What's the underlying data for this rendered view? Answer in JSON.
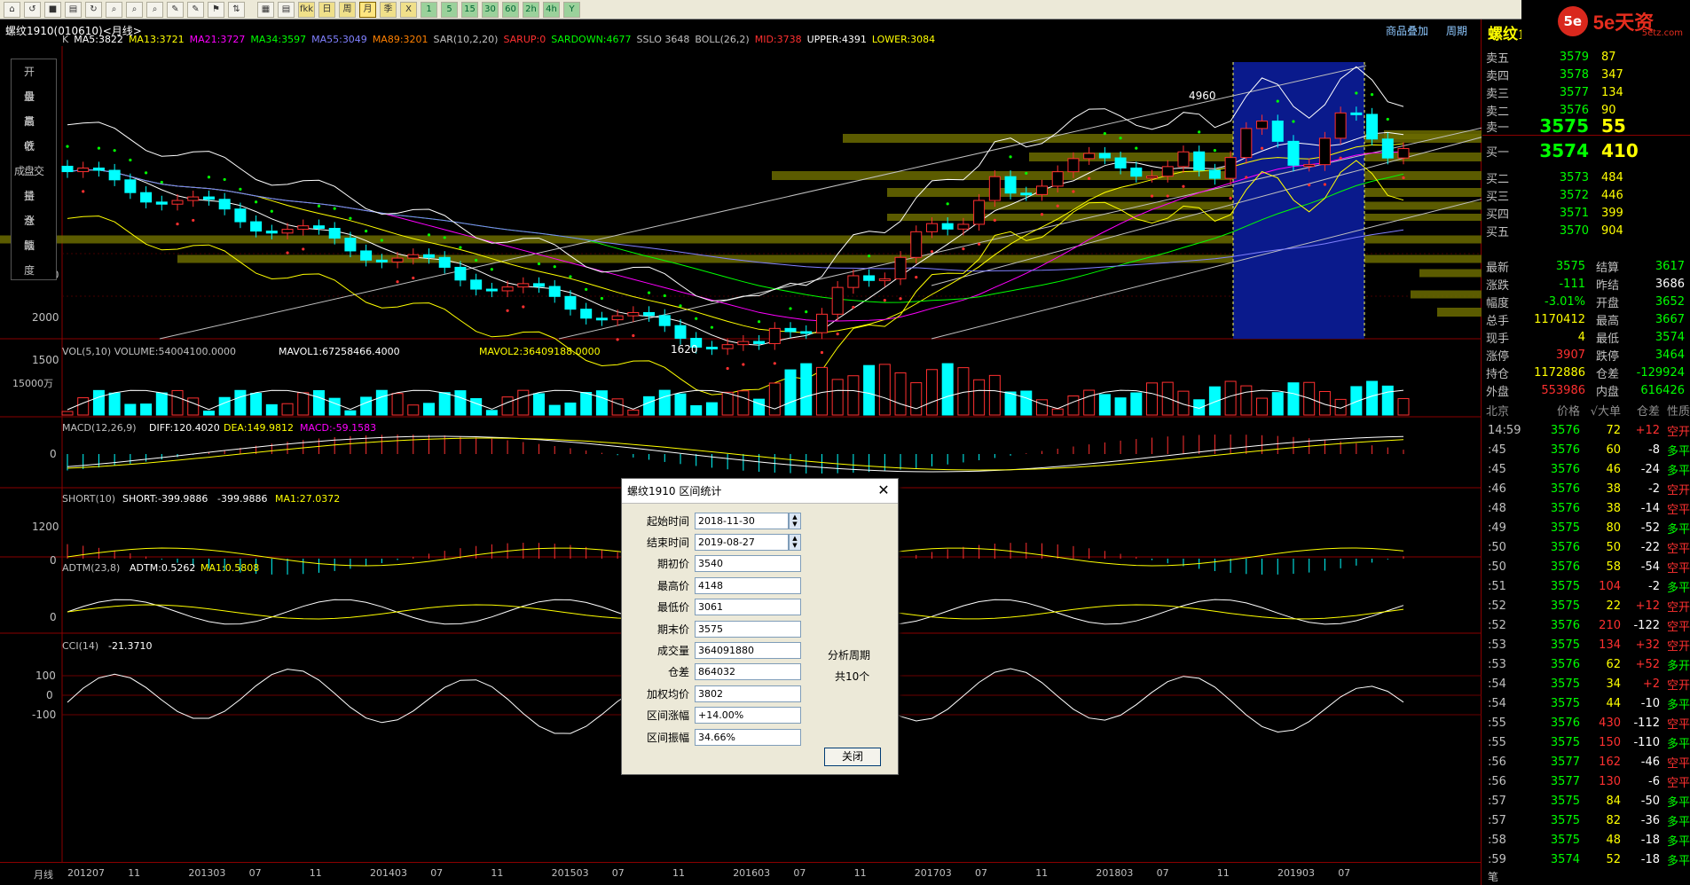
{
  "toolbar": {
    "period_buttons": [
      "1",
      "5",
      "15",
      "30",
      "60",
      "2h",
      "4h",
      "Y"
    ],
    "other_buttons": [
      "fkk",
      "日",
      "周",
      "月",
      "季",
      "X"
    ],
    "selected": "月"
  },
  "brand": {
    "logo": "5e",
    "text": "5e天资",
    "sub": "5etz.com"
  },
  "chart": {
    "title": "螺纹1910(010610)<月线>",
    "links": [
      "商品叠加",
      "周期"
    ],
    "main_indicator_line": [
      {
        "text": "K",
        "color": "#c0c0c0"
      },
      {
        "text": "MA5:3822",
        "color": "#ffffff"
      },
      {
        "text": "MA13:3721",
        "color": "#ffff00"
      },
      {
        "text": "MA21:3727",
        "color": "#ff00ff"
      },
      {
        "text": "MA34:3597",
        "color": "#00ff00"
      },
      {
        "text": "MA55:3049",
        "color": "#8080ff"
      },
      {
        "text": "MA89:3201",
        "color": "#ff8000"
      },
      {
        "text": "SAR(10,2,20)",
        "color": "#c0c0c0"
      },
      {
        "text": "SARUP:0",
        "color": "#ff3030"
      },
      {
        "text": "SARDOWN:4677",
        "color": "#00ff00"
      },
      {
        "text": "SSLO 3648",
        "color": "#c0c0c0"
      },
      {
        "text": "BOLL(26,2)",
        "color": "#c0c0c0"
      },
      {
        "text": "MID:3738",
        "color": "#ff3030"
      },
      {
        "text": "UPPER:4391",
        "color": "#ffffff"
      },
      {
        "text": "LOWER:3084",
        "color": "#ffff00"
      }
    ],
    "left_panel": [
      "开 盘",
      "最 高",
      "最 低",
      "收 盘",
      "成交量",
      "持 仓",
      "涨 跌",
      "幅 度"
    ],
    "y_labels": [
      "2500",
      "2000",
      "1500"
    ],
    "annotations": {
      "high": "4960",
      "low": "1620"
    },
    "vol": {
      "label": "VOL(5,10) VOLUME:54004100.0000",
      "mavol1": "MAVOL1:67258466.4000",
      "mavol2": "MAVOL2:36409188.0000",
      "y": "15000万"
    },
    "macd": {
      "label": "MACD(12,26,9)",
      "diff": "DIFF:120.4020",
      "dea": "DEA:149.9812",
      "macd": "MACD:-59.1583",
      "y": "0"
    },
    "short": {
      "label": "SHORT(10)",
      "v1": "SHORT:-399.9886",
      "v2": "-399.9886",
      "ma": "MA1:27.0372",
      "y1": "1200",
      "y0": "0"
    },
    "adtm": {
      "label": "ADTM(23,8)",
      "v": "ADTM:0.5262",
      "ma": "MA1:0.5808",
      "y": "0"
    },
    "cci": {
      "label": "CCI(14)",
      "v": "-21.3710",
      "y1": "100",
      "y0": "0",
      "y2": "-100"
    },
    "xaxis": {
      "label": "月线",
      "ticks": [
        "201207",
        "11",
        "201303",
        "07",
        "11",
        "201403",
        "07",
        "11",
        "201503",
        "07",
        "11",
        "201603",
        "07",
        "11",
        "201703",
        "07",
        "11",
        "201803",
        "07",
        "11",
        "201903",
        "07"
      ]
    }
  },
  "dialog": {
    "title": "螺纹1910 区间统计",
    "fields": [
      {
        "label": "起始时间",
        "value": "2018-11-30",
        "spin": true
      },
      {
        "label": "结束时间",
        "value": "2019-08-27",
        "spin": true
      },
      {
        "label": "期初价",
        "value": "3540"
      },
      {
        "label": "最高价",
        "value": "4148"
      },
      {
        "label": "最低价",
        "value": "3061"
      },
      {
        "label": "期末价",
        "value": "3575"
      },
      {
        "label": "成交量",
        "value": "364091880"
      },
      {
        "label": "仓差",
        "value": "864032"
      },
      {
        "label": "加权均价",
        "value": "3802"
      },
      {
        "label": "区间涨幅",
        "value": "+14.00%"
      },
      {
        "label": "区间振幅",
        "value": "34.66%"
      }
    ],
    "period_label": "分析周期",
    "period_value": "共10个",
    "close": "关闭"
  },
  "quote": {
    "title": "螺纹1910(rb1910)",
    "sells": [
      {
        "l": "卖五",
        "p": "3579",
        "v": "87"
      },
      {
        "l": "卖四",
        "p": "3578",
        "v": "347"
      },
      {
        "l": "卖三",
        "p": "3577",
        "v": "134"
      },
      {
        "l": "卖二",
        "p": "3576",
        "v": "90"
      }
    ],
    "sell1": {
      "l": "卖一",
      "p": "3575",
      "v": "55"
    },
    "buy1": {
      "l": "买一",
      "p": "3574",
      "v": "410"
    },
    "buys": [
      {
        "l": "买二",
        "p": "3573",
        "v": "484"
      },
      {
        "l": "买三",
        "p": "3572",
        "v": "446"
      },
      {
        "l": "买四",
        "p": "3571",
        "v": "399"
      },
      {
        "l": "买五",
        "p": "3570",
        "v": "904"
      }
    ],
    "stats": [
      {
        "l1": "最新",
        "v1": "3575",
        "c1": "#00ff00",
        "l2": "结算",
        "v2": "3617",
        "c2": "#00ff00"
      },
      {
        "l1": "涨跌",
        "v1": "-111",
        "c1": "#00ff00",
        "l2": "昨结",
        "v2": "3686",
        "c2": "#ffffff"
      },
      {
        "l1": "幅度",
        "v1": "-3.01%",
        "c1": "#00ff00",
        "l2": "开盘",
        "v2": "3652",
        "c2": "#00ff00"
      },
      {
        "l1": "总手",
        "v1": "1170412",
        "c1": "#ffff00",
        "l2": "最高",
        "v2": "3667",
        "c2": "#00ff00"
      },
      {
        "l1": "现手",
        "v1": "4",
        "c1": "#ffff00",
        "l2": "最低",
        "v2": "3574",
        "c2": "#00ff00"
      },
      {
        "l1": "涨停",
        "v1": "3907",
        "c1": "#ff3030",
        "l2": "跌停",
        "v2": "3464",
        "c2": "#00ff00"
      },
      {
        "l1": "持仓",
        "v1": "1172886",
        "c1": "#ffff00",
        "l2": "仓差",
        "v2": "-129924",
        "c2": "#00ff00"
      },
      {
        "l1": "外盘",
        "v1": "553986",
        "c1": "#ff3030",
        "l2": "内盘",
        "v2": "616426",
        "c2": "#00ff00"
      }
    ],
    "trade_header": [
      "北京",
      "价格",
      "√大单",
      "仓差",
      "性质"
    ],
    "trades": [
      {
        "t": "14:59",
        "p": "3576",
        "v": "72",
        "d": "+12",
        "n": "空开"
      },
      {
        "t": ":45",
        "p": "3576",
        "v": "60",
        "d": "-8",
        "n": "多平"
      },
      {
        "t": ":45",
        "p": "3576",
        "v": "46",
        "d": "-24",
        "n": "多平"
      },
      {
        "t": ":46",
        "p": "3576",
        "v": "38",
        "d": "-2",
        "n": "空开"
      },
      {
        "t": ":48",
        "p": "3576",
        "v": "38",
        "d": "-14",
        "n": "空平"
      },
      {
        "t": ":49",
        "p": "3575",
        "v": "80",
        "d": "-52",
        "n": "多平"
      },
      {
        "t": ":50",
        "p": "3576",
        "v": "50",
        "d": "-22",
        "n": "空平"
      },
      {
        "t": ":50",
        "p": "3576",
        "v": "58",
        "d": "-54",
        "n": "空平"
      },
      {
        "t": ":51",
        "p": "3575",
        "v": "104",
        "d": "-2",
        "n": "多平"
      },
      {
        "t": ":52",
        "p": "3575",
        "v": "22",
        "d": "+12",
        "n": "空开"
      },
      {
        "t": ":52",
        "p": "3576",
        "v": "210",
        "d": "-122",
        "n": "空平"
      },
      {
        "t": ":53",
        "p": "3575",
        "v": "134",
        "d": "+32",
        "n": "空开"
      },
      {
        "t": ":53",
        "p": "3576",
        "v": "62",
        "d": "+52",
        "n": "多开"
      },
      {
        "t": ":54",
        "p": "3575",
        "v": "34",
        "d": "+2",
        "n": "空开"
      },
      {
        "t": ":54",
        "p": "3575",
        "v": "44",
        "d": "-10",
        "n": "多平"
      },
      {
        "t": ":55",
        "p": "3576",
        "v": "430",
        "d": "-112",
        "n": "空平"
      },
      {
        "t": ":55",
        "p": "3575",
        "v": "150",
        "d": "-110",
        "n": "多平"
      },
      {
        "t": ":56",
        "p": "3577",
        "v": "162",
        "d": "-46",
        "n": "空平"
      },
      {
        "t": ":56",
        "p": "3577",
        "v": "130",
        "d": "-6",
        "n": "空平"
      },
      {
        "t": ":57",
        "p": "3575",
        "v": "84",
        "d": "-50",
        "n": "多平"
      },
      {
        "t": ":57",
        "p": "3575",
        "v": "82",
        "d": "-36",
        "n": "多平"
      },
      {
        "t": ":58",
        "p": "3575",
        "v": "48",
        "d": "-18",
        "n": "多平"
      },
      {
        "t": ":59",
        "p": "3574",
        "v": "52",
        "d": "-18",
        "n": "多平"
      }
    ],
    "footer": "笔"
  }
}
